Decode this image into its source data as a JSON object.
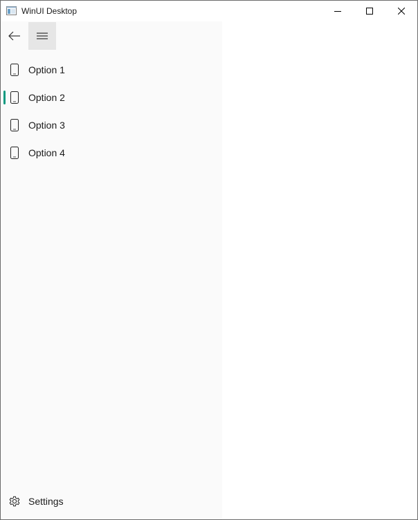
{
  "window": {
    "title": "WinUI Desktop"
  },
  "nav": {
    "items": [
      {
        "label": "Option 1",
        "icon": "phone-icon",
        "selected": false
      },
      {
        "label": "Option 2",
        "icon": "phone-icon",
        "selected": true
      },
      {
        "label": "Option 3",
        "icon": "phone-icon",
        "selected": false
      },
      {
        "label": "Option 4",
        "icon": "phone-icon",
        "selected": false
      }
    ],
    "settings_label": "Settings"
  },
  "colors": {
    "accent": "#0e9a80",
    "pane_background": "#fafafa",
    "menu_button_background": "#e6e6e6"
  }
}
